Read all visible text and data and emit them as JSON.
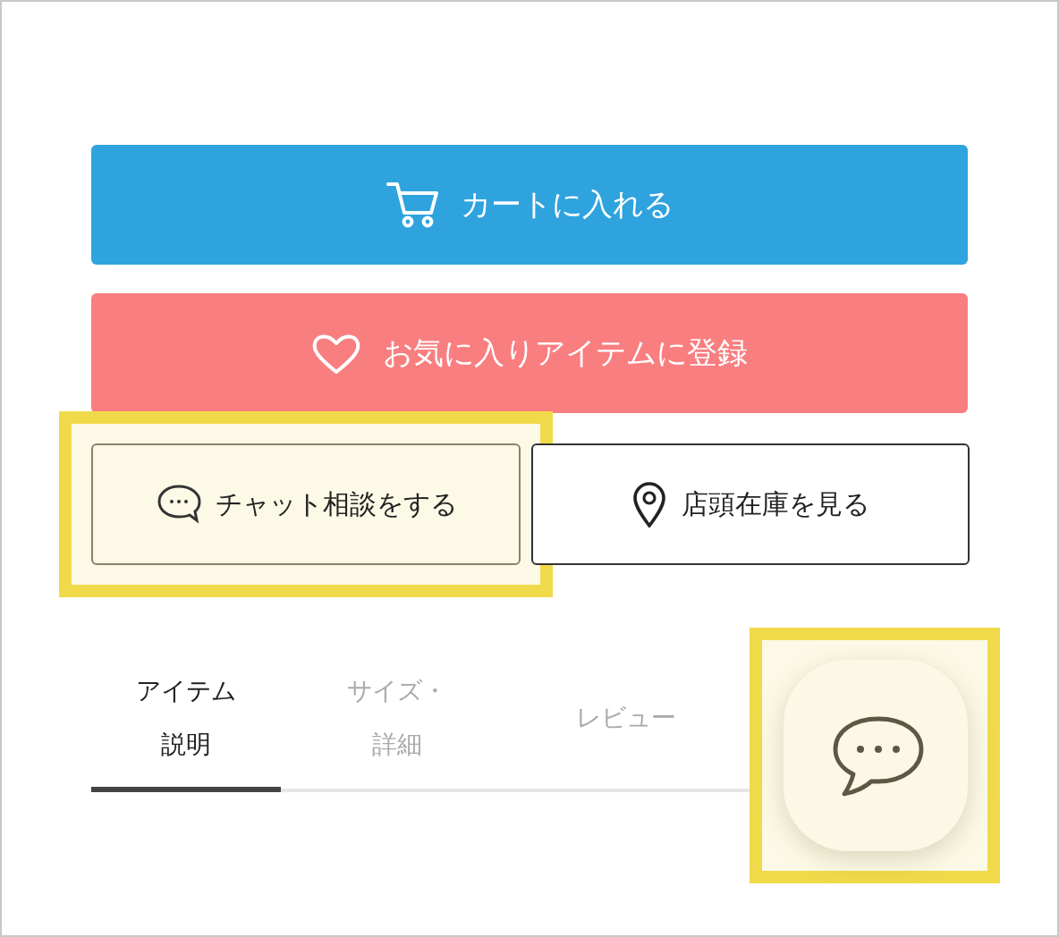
{
  "buttons": [
    {
      "kind": "cart",
      "label": "カートに入れる"
    },
    {
      "kind": "favorite",
      "label": "お気に入りアイテムに登録"
    }
  ],
  "secondary_buttons": [
    {
      "kind": "chat",
      "label": "チャット相談をする",
      "highlighted": true
    },
    {
      "kind": "store",
      "label": "店頭在庫を見る",
      "highlighted": false
    }
  ],
  "tabs": [
    {
      "label": "アイテム説明",
      "selected": true
    },
    {
      "label": "サイズ・詳細",
      "selected": false
    },
    {
      "label": "レビュー",
      "selected": false
    }
  ],
  "chat_fab": {
    "highlighted": true
  }
}
